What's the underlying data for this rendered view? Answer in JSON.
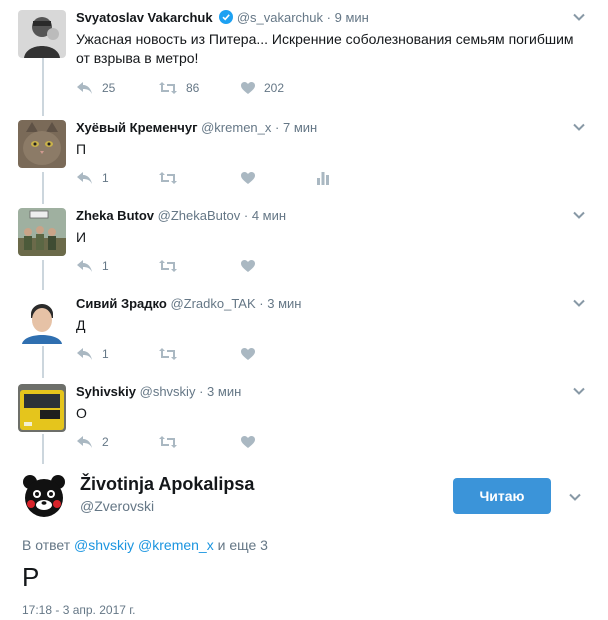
{
  "tweets": [
    {
      "name": "Svyatoslav Vakarchuk",
      "handle": "@s_vakarchuk",
      "time": "9 мин",
      "verified": true,
      "text": "Ужасная новость из Питера... Искренние соболезнования семьям погибшим от взрыва в метро!",
      "replies": "25",
      "retweets": "86",
      "likes": "202",
      "avatar_icon": "man-portrait-icon"
    },
    {
      "name": "Хуёвый Кременчуг",
      "handle": "@kremen_x",
      "time": "7 мин",
      "text": "П",
      "replies": "1",
      "retweets": "",
      "likes": "",
      "avatar_icon": "cat-photo-icon"
    },
    {
      "name": "Zheka Butov",
      "handle": "@ZhekaButov",
      "time": "4 мин",
      "text": "И",
      "replies": "1",
      "retweets": "",
      "likes": "",
      "avatar_icon": "group-photo-icon"
    },
    {
      "name": "Сивий Зрадко",
      "handle": "@Zradko_TAK",
      "time": "3 мин",
      "text": "Д",
      "replies": "1",
      "retweets": "",
      "likes": "",
      "avatar_icon": "boy-portrait-icon"
    },
    {
      "name": "Syhivskiy",
      "handle": "@shvskiy",
      "time": "3 мин",
      "text": "О",
      "replies": "2",
      "retweets": "",
      "likes": "",
      "avatar_icon": "tram-photo-icon"
    }
  ],
  "main_tweet": {
    "name": "Životinja Apokalipsa",
    "handle": "@Zverovski",
    "follow_label": "Читаю",
    "reply_prefix": "В ответ",
    "reply_mention_1": "@shvskiy",
    "reply_mention_2": "@kremen_x",
    "reply_suffix": "и еще 3",
    "text": "Р",
    "timestamp": "17:18 - 3 апр. 2017 г.",
    "avatar_icon": "kumamon-bear-icon"
  },
  "colors": {
    "accent": "#1b95e0",
    "button": "#3b94d9",
    "muted": "#657786",
    "thread_line": "#ccd6dd"
  }
}
